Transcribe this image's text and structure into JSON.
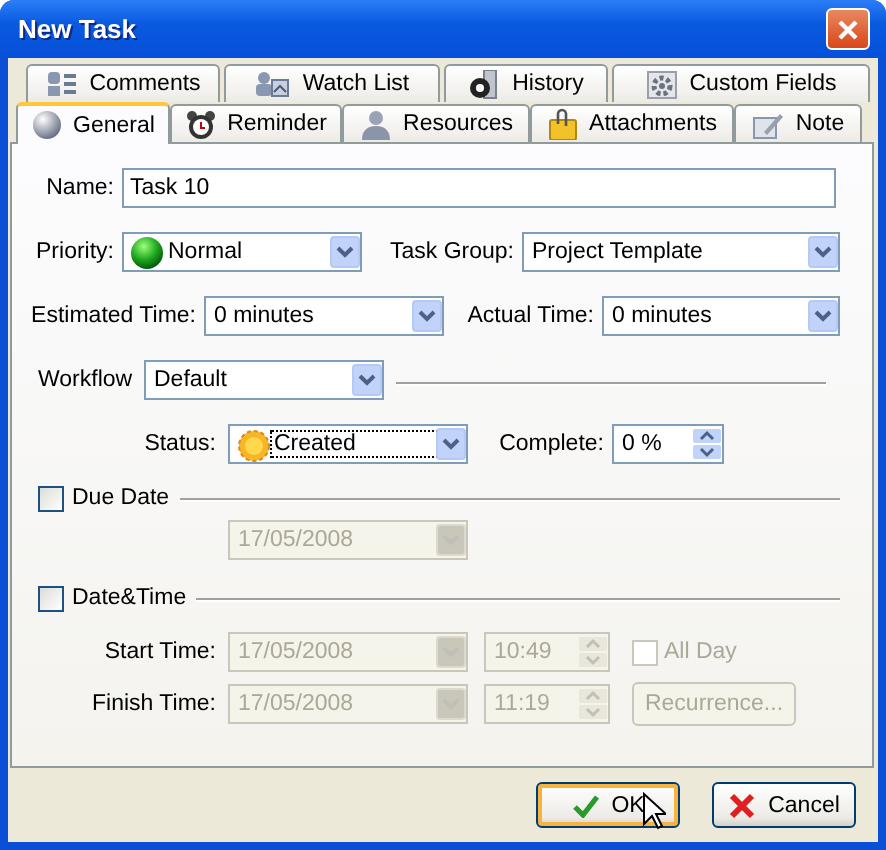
{
  "window": {
    "title": "New Task"
  },
  "tab_rows": [
    [
      {
        "label": "Comments",
        "kind": "comments",
        "selected": false
      },
      {
        "label": "Watch List",
        "kind": "watch",
        "selected": false
      },
      {
        "label": "History",
        "kind": "history",
        "selected": false
      },
      {
        "label": "Custom Fields",
        "kind": "fields",
        "selected": false
      }
    ],
    [
      {
        "label": "General",
        "kind": "general",
        "selected": true
      },
      {
        "label": "Reminder",
        "kind": "reminder",
        "selected": false
      },
      {
        "label": "Resources",
        "kind": "resources",
        "selected": false
      },
      {
        "label": "Attachments",
        "kind": "attachments",
        "selected": false
      },
      {
        "label": "Note",
        "kind": "note",
        "selected": false
      }
    ]
  ],
  "name": {
    "label": "Name:",
    "value": "Task 10"
  },
  "priority": {
    "label": "Priority:",
    "value": "Normal"
  },
  "task_group": {
    "label": "Task Group:",
    "value": "Project Template"
  },
  "estimated_time": {
    "label": "Estimated Time:",
    "value": "0 minutes"
  },
  "actual_time": {
    "label": "Actual Time:",
    "value": "0 minutes"
  },
  "workflow": {
    "label": "Workflow",
    "value": "Default"
  },
  "status": {
    "label": "Status:",
    "value": "Created",
    "focused": true
  },
  "complete": {
    "label": "Complete:",
    "value": "0 %"
  },
  "due_date": {
    "label": "Due Date",
    "checked": false,
    "date": {
      "value": "17/05/2008",
      "disabled": true
    }
  },
  "date_time": {
    "label": "Date&Time",
    "checked": false,
    "start_time": {
      "label": "Start Time:",
      "date": {
        "value": "17/05/2008",
        "disabled": true
      },
      "time": {
        "value": "10:49",
        "disabled": true
      }
    },
    "all_day": {
      "label": "All Day",
      "checked": false,
      "disabled": true
    },
    "finish_time": {
      "label": "Finish Time:",
      "date": {
        "value": "17/05/2008",
        "disabled": true
      },
      "time": {
        "value": "11:19",
        "disabled": true
      }
    },
    "recurrence": {
      "label": "Recurrence...",
      "disabled": true
    }
  },
  "buttons": [
    {
      "label": "OK",
      "kind": "ok",
      "default": true
    },
    {
      "label": "Cancel",
      "kind": "cancel",
      "default": false
    }
  ]
}
